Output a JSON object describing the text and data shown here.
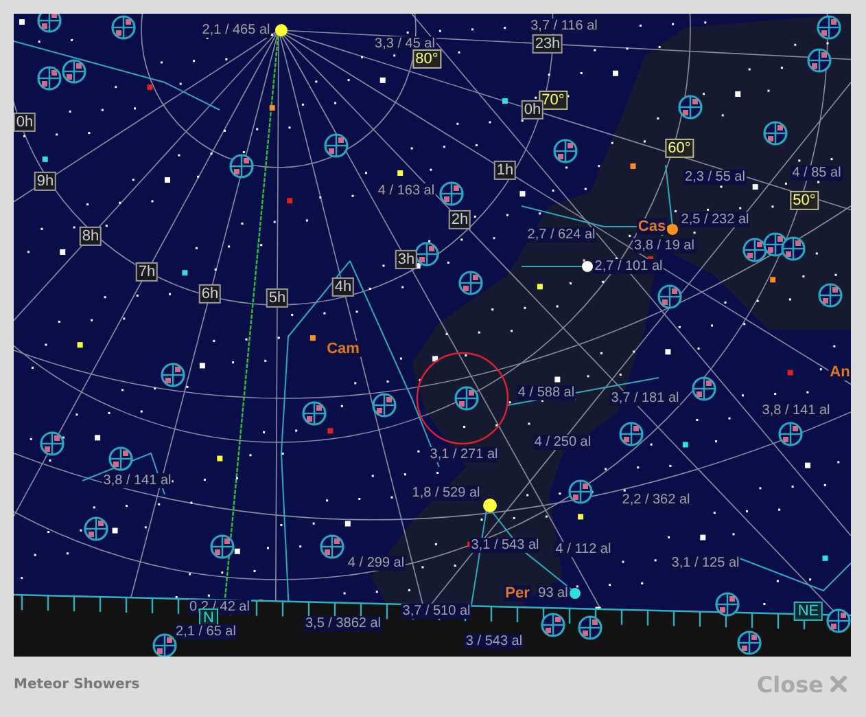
{
  "chart": {
    "labels": [
      {
        "text": "2,1 / 465 al",
        "kind": "star"
      },
      {
        "text": "3,3 / 45 al",
        "kind": "star"
      },
      {
        "text": "3,7 / 116 al",
        "kind": "star"
      },
      {
        "text": "80°",
        "kind": "degree"
      },
      {
        "text": "23h",
        "kind": "hour"
      },
      {
        "text": "70°",
        "kind": "degree"
      },
      {
        "text": "0h",
        "kind": "hour"
      },
      {
        "text": "0h",
        "kind": "hour"
      },
      {
        "text": "60°",
        "kind": "degree"
      },
      {
        "text": "1h",
        "kind": "hour"
      },
      {
        "text": "2,3 / 55 al",
        "kind": "star"
      },
      {
        "text": "4 / 85 al",
        "kind": "star"
      },
      {
        "text": "9h",
        "kind": "hour"
      },
      {
        "text": "4 / 163 al",
        "kind": "star"
      },
      {
        "text": "50°",
        "kind": "degree"
      },
      {
        "text": "2h",
        "kind": "hour"
      },
      {
        "text": "Cas",
        "kind": "constellation"
      },
      {
        "text": "2,5 / 232 al",
        "kind": "star"
      },
      {
        "text": "2,7 / 624 al",
        "kind": "star"
      },
      {
        "text": "8h",
        "kind": "hour"
      },
      {
        "text": "3,8 / 19 al",
        "kind": "star"
      },
      {
        "text": "3h",
        "kind": "hour"
      },
      {
        "text": "2,7 / 101 al",
        "kind": "star"
      },
      {
        "text": "7h",
        "kind": "hour"
      },
      {
        "text": "6h",
        "kind": "hour"
      },
      {
        "text": "5h",
        "kind": "hour"
      },
      {
        "text": "4h",
        "kind": "hour"
      },
      {
        "text": "Cam",
        "kind": "constellation"
      },
      {
        "text": "An",
        "kind": "constellation"
      },
      {
        "text": "4 / 588 al",
        "kind": "star"
      },
      {
        "text": "3,7 / 181 al",
        "kind": "star"
      },
      {
        "text": "3,8 / 141 al",
        "kind": "star"
      },
      {
        "text": "4 / 250 al",
        "kind": "star"
      },
      {
        "text": "3,1 / 271 al",
        "kind": "star"
      },
      {
        "text": "3,8 / 141 al",
        "kind": "star"
      },
      {
        "text": "1,8 / 529 al",
        "kind": "star"
      },
      {
        "text": "2,2 / 362 al",
        "kind": "star"
      },
      {
        "text": "3,1 / 543 al",
        "kind": "star"
      },
      {
        "text": "4 / 112 al",
        "kind": "star"
      },
      {
        "text": "4 / 299 al",
        "kind": "star"
      },
      {
        "text": "3,1 / 125 al",
        "kind": "star"
      },
      {
        "text": "Per",
        "kind": "constellation"
      },
      {
        "text": "93 al",
        "kind": "star"
      },
      {
        "text": "0,2 / 42 al",
        "kind": "star"
      },
      {
        "text": "3,7 / 510 al",
        "kind": "star"
      },
      {
        "text": "N",
        "kind": "horizon"
      },
      {
        "text": "NE",
        "kind": "horizon"
      },
      {
        "text": "3,5 / 3862 al",
        "kind": "star"
      },
      {
        "text": "2,1 / 65 al",
        "kind": "star"
      },
      {
        "text": "3 / 543 al",
        "kind": "star"
      }
    ]
  },
  "footer": {
    "title": "Meteor Showers",
    "close": "Close"
  }
}
